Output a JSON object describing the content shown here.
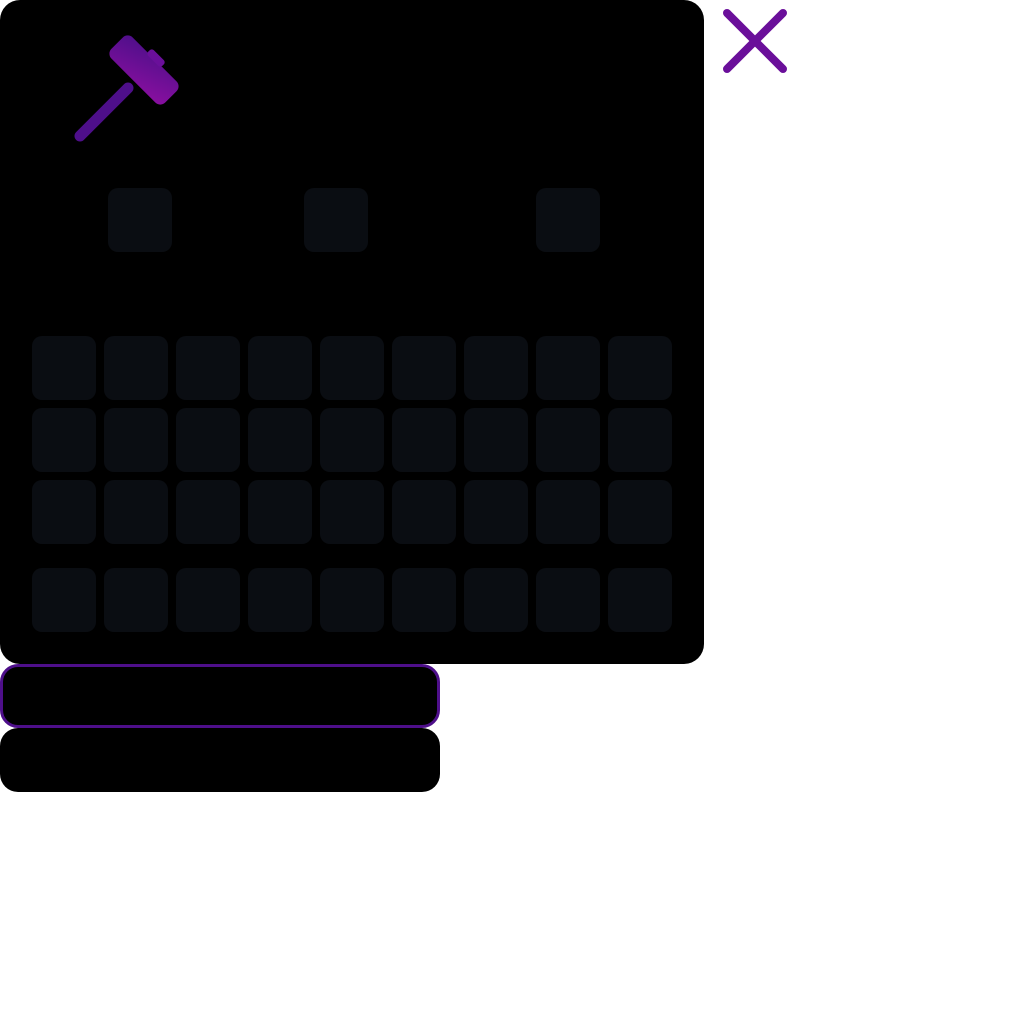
{
  "icons": {
    "hammer": "hammer-icon",
    "close": "close-icon"
  },
  "colors": {
    "accent_dark": "#4e0f8a",
    "accent": "#6a0f9a",
    "accent_light": "#8a0fa0",
    "panel": "#000000",
    "tile": "#0a0d12"
  },
  "word_slots": [
    {
      "id": 1,
      "value": ""
    },
    {
      "id": 2,
      "value": ""
    },
    {
      "id": 3,
      "value": ""
    }
  ],
  "keyboard": {
    "rows": [
      [
        "",
        "",
        "",
        "",
        "",
        "",
        "",
        "",
        ""
      ],
      [
        "",
        "",
        "",
        "",
        "",
        "",
        "",
        "",
        ""
      ],
      [
        "",
        "",
        "",
        "",
        "",
        "",
        "",
        "",
        ""
      ],
      [
        "",
        "",
        "",
        "",
        "",
        "",
        "",
        "",
        ""
      ]
    ]
  },
  "actions": {
    "primary_label": "",
    "secondary_label": ""
  }
}
